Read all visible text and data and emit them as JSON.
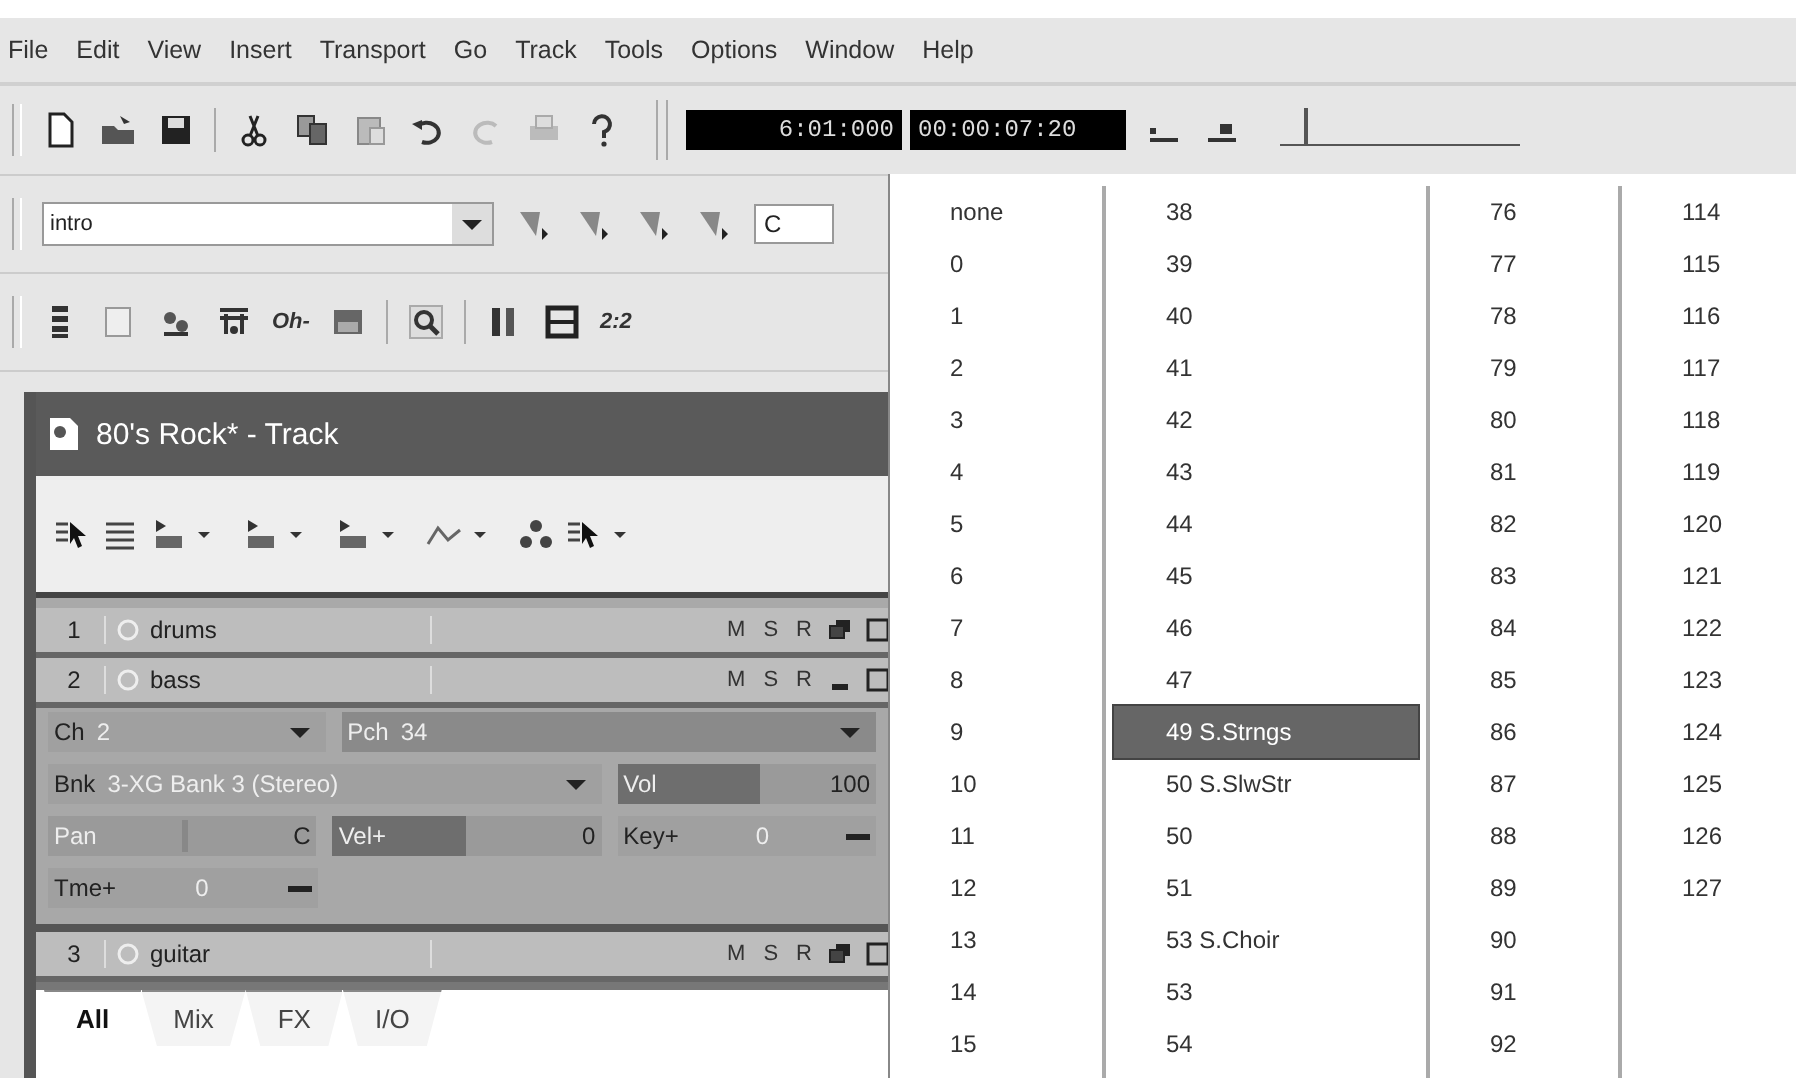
{
  "menu": [
    "File",
    "Edit",
    "View",
    "Insert",
    "Transport",
    "Go",
    "Track",
    "Tools",
    "Options",
    "Window",
    "Help"
  ],
  "toolbar": {
    "position": "6:01:000",
    "timecode": "00:00:07:20",
    "zoom_slider": {
      "level": 0.1
    }
  },
  "markers": {
    "value": "intro",
    "field": "C"
  },
  "views_toolbar": {
    "channel_button": "Oh-",
    "meter_button": "2:2"
  },
  "track_window": {
    "title": "80's Rock* - Track",
    "tracks": [
      {
        "number": "1",
        "name": "drums",
        "flags": [
          "M",
          "S",
          "R"
        ],
        "expanded": false
      },
      {
        "number": "2",
        "name": "bass",
        "flags": [
          "M",
          "S",
          "R"
        ],
        "expanded": true
      },
      {
        "number": "3",
        "name": "guitar",
        "flags": [
          "M",
          "S",
          "R"
        ],
        "expanded": false
      }
    ],
    "controls": {
      "channel": {
        "label": "Ch",
        "value": "2"
      },
      "patch": {
        "label": "Pch",
        "value": "34"
      },
      "bank": {
        "label": "Bnk",
        "value": "3-XG Bank 3 (Stereo)"
      },
      "volume": {
        "label": "Vol",
        "value": "100",
        "level": 0.55
      },
      "pan": {
        "label": "Pan",
        "value": "C",
        "level": 0.5
      },
      "velocity": {
        "label": "Vel+",
        "value": "0",
        "level": 0.5
      },
      "key": {
        "label": "Key+",
        "value": "0"
      },
      "time": {
        "label": "Tme+",
        "value": "0"
      }
    },
    "tabs": [
      {
        "label": "All",
        "selected": true
      },
      {
        "label": "Mix",
        "selected": false
      },
      {
        "label": "FX",
        "selected": false
      },
      {
        "label": "I/O",
        "selected": false
      }
    ]
  },
  "patch_list": {
    "columns": [
      [
        {
          "label": "none",
          "selected": false
        },
        {
          "label": "0",
          "selected": false
        },
        {
          "label": "1",
          "selected": false
        },
        {
          "label": "2",
          "selected": false
        },
        {
          "label": "3",
          "selected": false
        },
        {
          "label": "4",
          "selected": false
        },
        {
          "label": "5",
          "selected": false
        },
        {
          "label": "6",
          "selected": false
        },
        {
          "label": "7",
          "selected": false
        },
        {
          "label": "8",
          "selected": false
        },
        {
          "label": "9",
          "selected": false
        },
        {
          "label": "10",
          "selected": false
        },
        {
          "label": "11",
          "selected": false
        },
        {
          "label": "12",
          "selected": false
        },
        {
          "label": "13",
          "selected": false
        },
        {
          "label": "14",
          "selected": false
        },
        {
          "label": "15",
          "selected": false
        }
      ],
      [
        {
          "label": "38",
          "selected": false
        },
        {
          "label": "39",
          "selected": false
        },
        {
          "label": "40",
          "selected": false
        },
        {
          "label": "41",
          "selected": false
        },
        {
          "label": "42",
          "selected": false
        },
        {
          "label": "43",
          "selected": false
        },
        {
          "label": "44",
          "selected": false
        },
        {
          "label": "45",
          "selected": false
        },
        {
          "label": "46",
          "selected": false
        },
        {
          "label": "47",
          "selected": false
        },
        {
          "label": "49 S.Strngs",
          "selected": true
        },
        {
          "label": "50 S.SlwStr",
          "selected": false
        },
        {
          "label": "50",
          "selected": false
        },
        {
          "label": "51",
          "selected": false
        },
        {
          "label": "53 S.Choir",
          "selected": false
        },
        {
          "label": "53",
          "selected": false
        },
        {
          "label": "54",
          "selected": false
        }
      ],
      [
        {
          "label": "76",
          "selected": false
        },
        {
          "label": "77",
          "selected": false
        },
        {
          "label": "78",
          "selected": false
        },
        {
          "label": "79",
          "selected": false
        },
        {
          "label": "80",
          "selected": false
        },
        {
          "label": "81",
          "selected": false
        },
        {
          "label": "82",
          "selected": false
        },
        {
          "label": "83",
          "selected": false
        },
        {
          "label": "84",
          "selected": false
        },
        {
          "label": "85",
          "selected": false
        },
        {
          "label": "86",
          "selected": false
        },
        {
          "label": "87",
          "selected": false
        },
        {
          "label": "88",
          "selected": false
        },
        {
          "label": "89",
          "selected": false
        },
        {
          "label": "90",
          "selected": false
        },
        {
          "label": "91",
          "selected": false
        },
        {
          "label": "92",
          "selected": false
        }
      ],
      [
        {
          "label": "114",
          "selected": false
        },
        {
          "label": "115",
          "selected": false
        },
        {
          "label": "116",
          "selected": false
        },
        {
          "label": "117",
          "selected": false
        },
        {
          "label": "118",
          "selected": false
        },
        {
          "label": "119",
          "selected": false
        },
        {
          "label": "120",
          "selected": false
        },
        {
          "label": "121",
          "selected": false
        },
        {
          "label": "122",
          "selected": false
        },
        {
          "label": "123",
          "selected": false
        },
        {
          "label": "124",
          "selected": false
        },
        {
          "label": "125",
          "selected": false
        },
        {
          "label": "126",
          "selected": false
        },
        {
          "label": "127",
          "selected": false
        }
      ]
    ]
  }
}
